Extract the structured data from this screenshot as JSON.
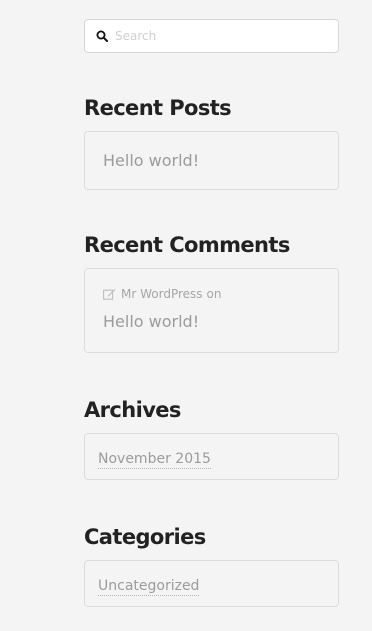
{
  "search": {
    "placeholder": "Search"
  },
  "recent_posts": {
    "title": "Recent Posts",
    "items": [
      {
        "label": "Hello world!"
      }
    ]
  },
  "recent_comments": {
    "title": "Recent Comments",
    "items": [
      {
        "author": "Mr WordPress",
        "connector": "on",
        "post": "Hello world!"
      }
    ]
  },
  "archives": {
    "title": "Archives",
    "items": [
      {
        "label": "November 2015"
      }
    ]
  },
  "categories": {
    "title": "Categories",
    "items": [
      {
        "label": "Uncategorized"
      }
    ]
  },
  "icons": {
    "search": "search-icon",
    "comment": "edit-icon"
  },
  "colors": {
    "background": "#f4f4f4",
    "heading": "#222222",
    "link": "#9b9b9b",
    "border": "#dcdcdc"
  }
}
